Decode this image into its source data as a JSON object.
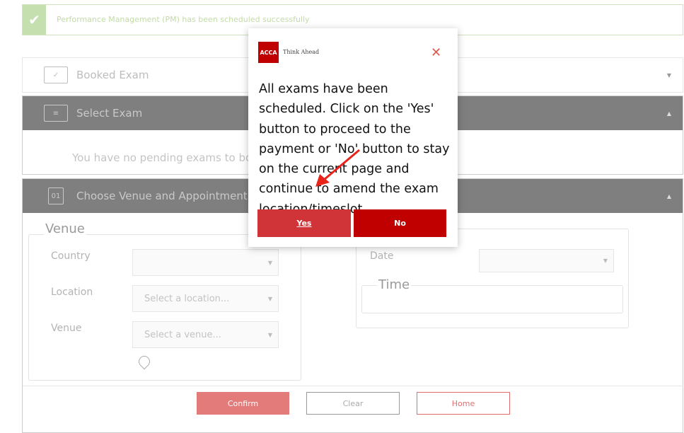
{
  "banner": {
    "message": "Performance Management (PM) has been scheduled successfully",
    "icon": "check-icon"
  },
  "panels": {
    "booked": {
      "title": "Booked Exam"
    },
    "select": {
      "title": "Select Exam",
      "empty_message": "You have no pending exams to book"
    },
    "venue": {
      "title": "Choose Venue and Appointment",
      "calendar_icon_text": "01"
    }
  },
  "venue_form": {
    "legend": "Venue",
    "country_label": "Country",
    "country_value": "",
    "location_label": "Location",
    "location_placeholder": "Select a location...",
    "venue_label": "Venue",
    "venue_placeholder": "Select a venue..."
  },
  "date_form": {
    "date_label": "Date",
    "date_value": "",
    "time_legend": "Time"
  },
  "actions": {
    "confirm": "Confirm",
    "clear": "Clear",
    "home": "Home"
  },
  "modal": {
    "logo_text": "ACCA",
    "tagline": "Think Ahead",
    "message": "All exams have been scheduled. Click on the 'Yes' button to proceed to the payment or 'No' button to stay on the current page and continue to amend the exam location/timeslot.",
    "yes": "Yes",
    "no": "No"
  },
  "colors": {
    "accent": "#c00000",
    "yes": "#d13438",
    "success": "#c6dfae",
    "header": "#7f7f7f"
  }
}
